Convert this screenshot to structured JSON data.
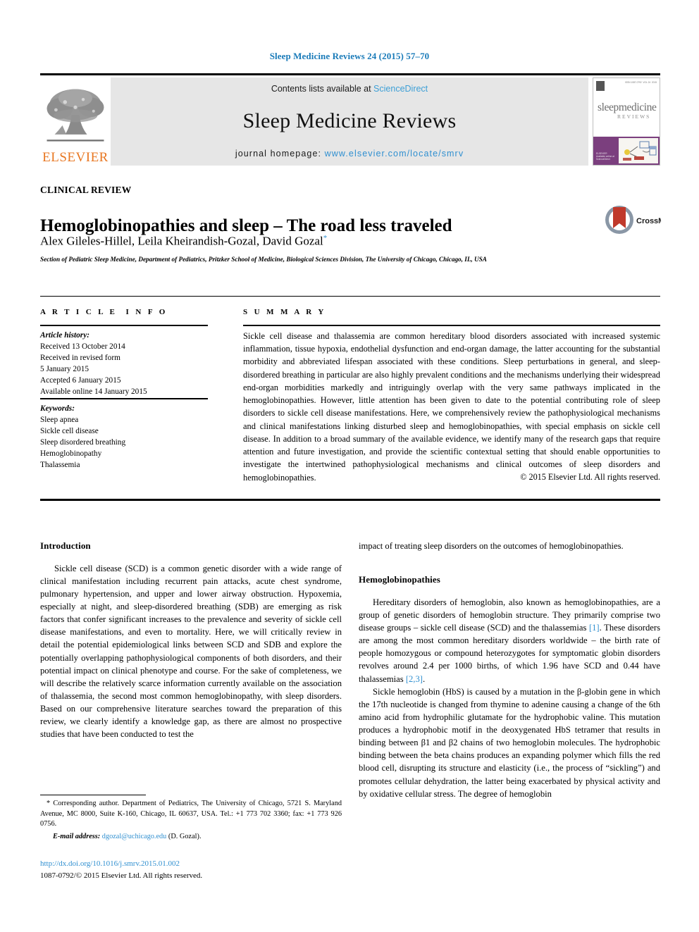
{
  "running_head": "Sleep Medicine Reviews 24 (2015) 57–70",
  "masthead": {
    "publisher": "ELSEVIER",
    "contents_prefix": "Contents lists available at ",
    "contents_link": "ScienceDirect",
    "journal_title": "Sleep Medicine Reviews",
    "homepage_prefix": "journal homepage: ",
    "homepage_url": "www.elsevier.com/locate/smrv",
    "cover": {
      "title": "sleepmedicine",
      "subtitle": "REVIEWS"
    }
  },
  "article": {
    "section_label": "CLINICAL REVIEW",
    "title": "Hemoglobinopathies and sleep – The road less traveled",
    "authors": "Alex Gileles-Hillel, Leila Kheirandish-Gozal, David Gozal",
    "corresponding_marker": "*",
    "affiliation": "Section of Pediatric Sleep Medicine, Department of Pediatrics, Pritzker School of Medicine, Biological Sciences Division, The University of Chicago, Chicago, IL, USA",
    "crossmark_label": "CrossMark"
  },
  "info": {
    "heading": "ARTICLE INFO",
    "history_heading": "Article history:",
    "history": [
      "Received 13 October 2014",
      "Received in revised form",
      "5 January 2015",
      "Accepted 6 January 2015",
      "Available online 14 January 2015"
    ],
    "keywords_heading": "Keywords:",
    "keywords": [
      "Sleep apnea",
      "Sickle cell disease",
      "Sleep disordered breathing",
      "Hemoglobinopathy",
      "Thalassemia"
    ]
  },
  "summary": {
    "heading": "SUMMARY",
    "text": "Sickle cell disease and thalassemia are common hereditary blood disorders associated with increased systemic inflammation, tissue hypoxia, endothelial dysfunction and end-organ damage, the latter accounting for the substantial morbidity and abbreviated lifespan associated with these conditions. Sleep perturbations in general, and sleep-disordered breathing in particular are also highly prevalent conditions and the mechanisms underlying their widespread end-organ morbidities markedly and intriguingly overlap with the very same pathways implicated in the hemoglobinopathies. However, little attention has been given to date to the potential contributing role of sleep disorders to sickle cell disease manifestations. Here, we comprehensively review the pathophysiological mechanisms and clinical manifestations linking disturbed sleep and hemoglobinopathies, with special emphasis on sickle cell disease. In addition to a broad summary of the available evidence, we identify many of the research gaps that require attention and future investigation, and provide the scientific contextual setting that should enable opportunities to investigate the intertwined pathophysiological mechanisms and clinical outcomes of sleep disorders and hemoglobinopathies.",
    "copyright": "© 2015 Elsevier Ltd. All rights reserved."
  },
  "body": {
    "left": {
      "heading": "Introduction",
      "paragraph": "Sickle cell disease (SCD) is a common genetic disorder with a wide range of clinical manifestation including recurrent pain attacks, acute chest syndrome, pulmonary hypertension, and upper and lower airway obstruction. Hypoxemia, especially at night, and sleep-disordered breathing (SDB) are emerging as risk factors that confer significant increases to the prevalence and severity of sickle cell disease manifestations, and even to mortality. Here, we will critically review in detail the potential epidemiological links between SCD and SDB and explore the potentially overlapping pathophysiological components of both disorders, and their potential impact on clinical phenotype and course. For the sake of completeness, we will describe the relatively scarce information currently available on the association of thalassemia, the second most common hemoglobinopathy, with sleep disorders. Based on our comprehensive literature searches toward the preparation of this review, we clearly identify a knowledge gap, as there are almost no prospective studies that have been conducted to test the"
    },
    "right": {
      "continuation": "impact of treating sleep disorders on the outcomes of hemoglobinopathies.",
      "heading": "Hemoglobinopathies",
      "paragraph_1_a": "Hereditary disorders of hemoglobin, also known as hemoglobinopathies, are a group of genetic disorders of hemoglobin structure. They primarily comprise two disease groups – sickle cell disease (SCD) and the thalassemias ",
      "paragraph_1_ref_1": "[1]",
      "paragraph_1_b": ". These disorders are among the most common hereditary disorders worldwide – the birth rate of people homozygous or compound heterozygotes for symptomatic globin disorders revolves around 2.4 per 1000 births, of which 1.96 have SCD and 0.44 have thalassemias ",
      "paragraph_1_ref_2": "[2,3]",
      "paragraph_1_c": ".",
      "paragraph_2": "Sickle hemoglobin (HbS) is caused by a mutation in the β-globin gene in which the 17th nucleotide is changed from thymine to adenine causing a change of the 6th amino acid from hydrophilic glutamate for the hydrophobic valine. This mutation produces a hydrophobic motif in the deoxygenated HbS tetramer that results in binding between β1 and β2 chains of two hemoglobin molecules. The hydrophobic binding between the beta chains produces an expanding polymer which fills the red blood cell, disrupting its structure and elasticity (i.e., the process of “sickling”) and promotes cellular dehydration, the latter being exacerbated by physical activity and by oxidative cellular stress. The degree of hemoglobin"
    }
  },
  "footnotes": {
    "corresponding": "* Corresponding author. Department of Pediatrics, The University of Chicago, 5721 S. Maryland Avenue, MC 8000, Suite K-160, Chicago, IL 60637, USA. Tel.: +1 773 702 3360; fax: +1 773 926 0756.",
    "email_label": "E-mail address:",
    "email": "dgozal@uchicago.edu",
    "email_suffix": "(D. Gozal).",
    "doi": "http://dx.doi.org/10.1016/j.smrv.2015.01.002",
    "issn_line": "1087-0792/© 2015 Elsevier Ltd. All rights reserved."
  },
  "colors": {
    "link_blue": "#2f8fd0",
    "elsevier_orange": "#E87722",
    "band_gray": "#e6e6e6"
  }
}
